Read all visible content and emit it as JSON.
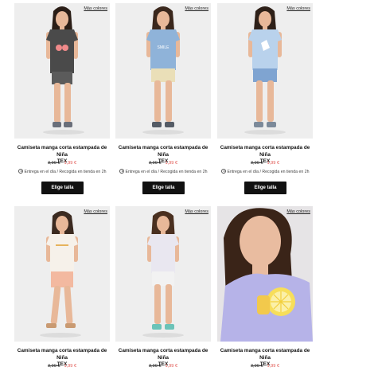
{
  "products": [
    {
      "more_colors": "Más colores",
      "title_line1": "Camiseta manga corta estampada de Niña",
      "title_line2": "TEX",
      "old_price": "3,99 €",
      "new_price": "1,99 €",
      "delivery": "Entrega en el día / Recogida en tienda en 2h",
      "button": "Elige talla",
      "shirt_color": "#4a4a4a",
      "bottom_color": "#5b5b5b",
      "print": "cherries"
    },
    {
      "more_colors": "Más colores",
      "title_line1": "Camiseta manga corta estampada de Niña",
      "title_line2": "TEX",
      "old_price": "3,99 €",
      "new_price": "1,99 €",
      "delivery": "Entrega en el día / Recogida en tienda en 2h",
      "button": "Elige talla",
      "shirt_color": "#8fb3d9",
      "bottom_color": "#eadfb8",
      "print": "smile"
    },
    {
      "more_colors": "Más colores",
      "title_line1": "Camiseta manga corta estampada de Niña",
      "title_line2": "TEX",
      "old_price": "3,99 €",
      "new_price": "1,99 €",
      "delivery": "Entrega en el día / Recogida en tienda en 2h",
      "button": "Elige talla",
      "shirt_color": "#b9d2ec",
      "bottom_color": "#7fa4d1",
      "print": "unicorn"
    },
    {
      "more_colors": "Más colores",
      "title_line1": "Camiseta manga corta estampada de Niña",
      "title_line2": "TEX",
      "old_price": "3,99 €",
      "new_price": "1,99 €",
      "shirt_color": "#f6f1ea",
      "bottom_color": "#f3b9a0",
      "print": "text"
    },
    {
      "more_colors": "Más colores",
      "title_line1": "Camiseta manga corta estampada de Niña",
      "title_line2": "TEX",
      "old_price": "3,99 €",
      "new_price": "1,99 €",
      "shirt_color": "#e9e7f0",
      "bottom_color": "#f2f2f2",
      "print": "none"
    },
    {
      "more_colors": "Más colores",
      "title_line1": "Camiseta manga corta estampada de Niña",
      "title_line2": "TEX",
      "old_price": "3,99 €",
      "new_price": "1,99 €",
      "shirt_color": "#b6b3e8",
      "bottom_color": "#b6b3e8",
      "print": "lemon"
    }
  ]
}
